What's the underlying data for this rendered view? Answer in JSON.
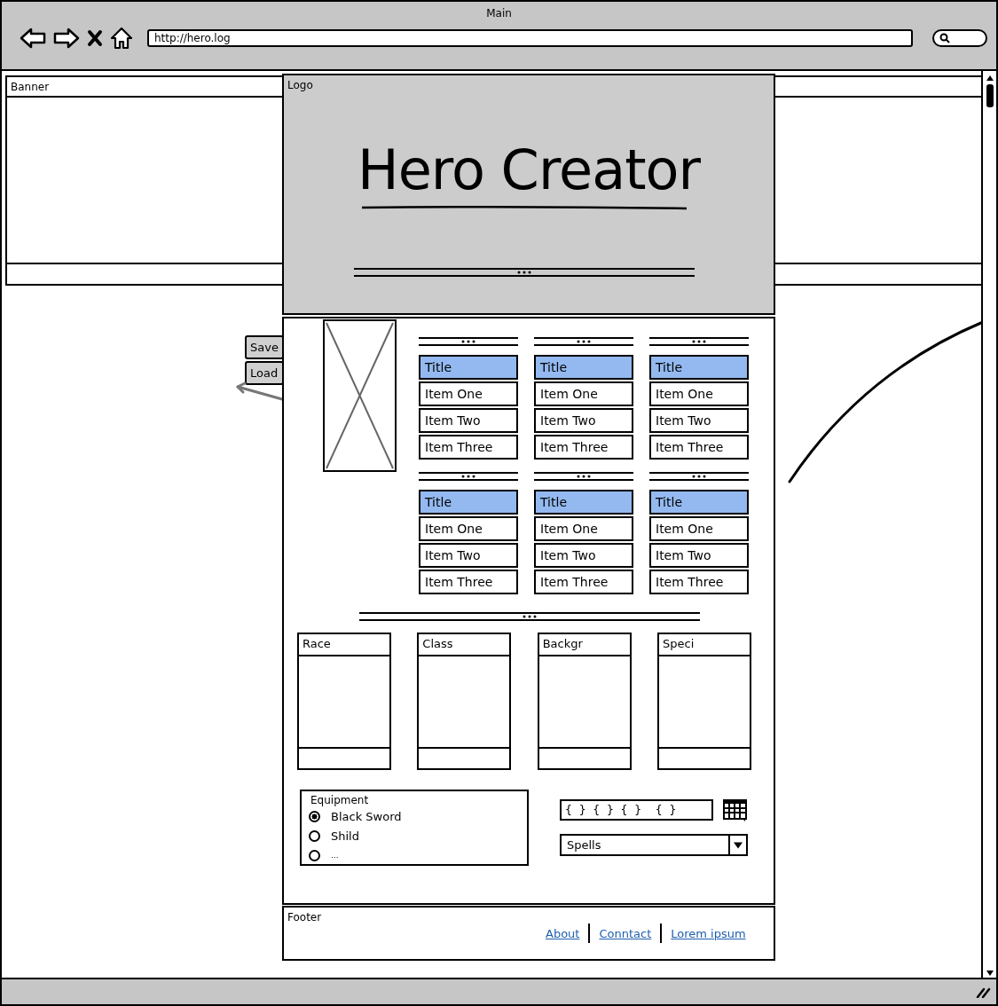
{
  "browser": {
    "title": "Main",
    "url": "http://hero.log"
  },
  "banner": {
    "label": "Banner"
  },
  "logo": {
    "label": "Logo",
    "heading": "Hero Creator"
  },
  "side_buttons": [
    "Save",
    "Load"
  ],
  "menu_groups": [
    {
      "title": "Title",
      "items": [
        "Item One",
        "Item Two",
        "Item Three"
      ]
    },
    {
      "title": "Title",
      "items": [
        "Item One",
        "Item Two",
        "Item Three"
      ]
    },
    {
      "title": "Title",
      "items": [
        "Item One",
        "Item Two",
        "Item Three"
      ]
    },
    {
      "title": "Title",
      "items": [
        "Item One",
        "Item Two",
        "Item Three"
      ]
    },
    {
      "title": "Title",
      "items": [
        "Item One",
        "Item Two",
        "Item Three"
      ]
    },
    {
      "title": "Title",
      "items": [
        "Item One",
        "Item Two",
        "Item Three"
      ]
    }
  ],
  "cards": [
    {
      "title": "Race"
    },
    {
      "title": "Class"
    },
    {
      "title": "Backgr"
    },
    {
      "title": "Speci"
    }
  ],
  "equipment": {
    "label": "Equipment",
    "options": [
      {
        "label": "Black Sword",
        "selected": true
      },
      {
        "label": "Shild",
        "selected": false
      },
      {
        "label": "...",
        "selected": false
      }
    ]
  },
  "pattern_field": {
    "value": "{ } { } { }  { }"
  },
  "dropdown": {
    "value": "Spells"
  },
  "footer": {
    "label": "Footer",
    "links": [
      "About",
      "Conntact",
      "Lorem ipsum"
    ]
  }
}
